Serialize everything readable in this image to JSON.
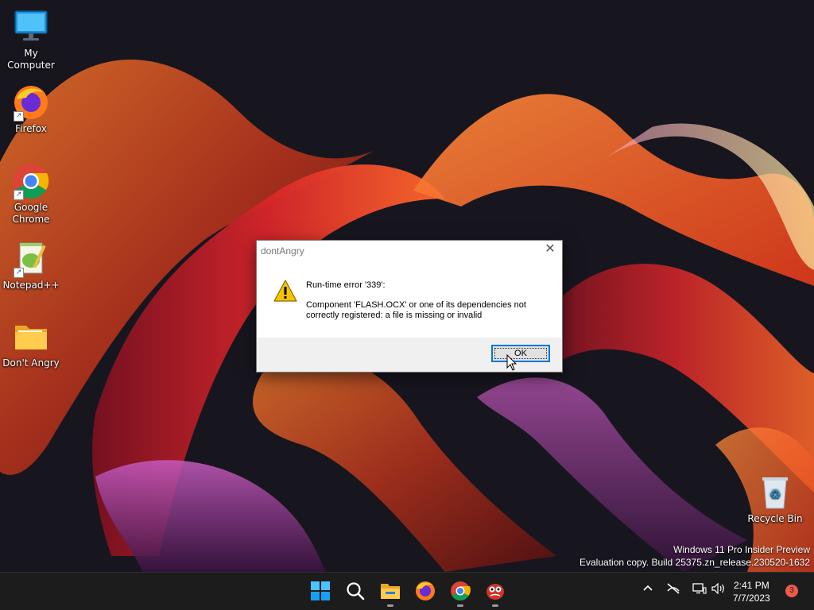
{
  "desktop": {
    "icons": [
      {
        "label": "My Computer",
        "icon": "monitor-icon"
      },
      {
        "label": "Firefox",
        "icon": "firefox-icon"
      },
      {
        "label": "Google Chrome",
        "icon": "chrome-icon"
      },
      {
        "label": "Notepad++",
        "icon": "notepadpp-icon"
      },
      {
        "label": "Don't Angry",
        "icon": "folder-icon"
      },
      {
        "label": "Recycle Bin",
        "icon": "recycle-bin-icon"
      }
    ],
    "watermark": {
      "line1": "Windows 11 Pro Insider Preview",
      "line2": "Evaluation copy. Build 25375.zn_release.230520-1632"
    }
  },
  "dialog": {
    "title": "dontAngry",
    "close_glyph": "✕",
    "message_title": "Run-time error '339':",
    "message_body": "Component 'FLASH.OCX' or one of its dependencies not correctly registered: a file is missing or invalid",
    "ok_label": "OK"
  },
  "taskbar": {
    "apps": [
      "start-icon",
      "search-icon",
      "file-explorer-icon",
      "firefox-icon",
      "chrome-icon",
      "dont-angry-app-icon"
    ],
    "tray": {
      "time": "2:41 PM",
      "date": "7/7/2023",
      "notification_count": "3"
    }
  }
}
